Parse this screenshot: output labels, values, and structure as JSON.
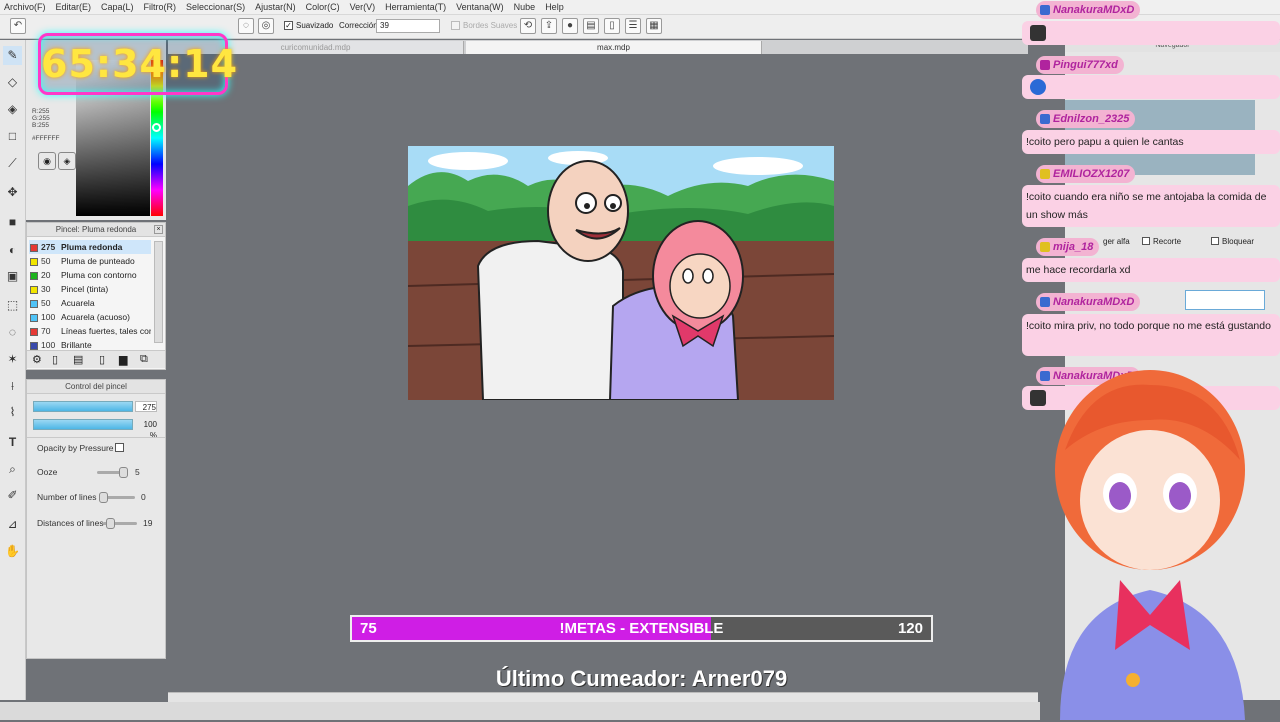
{
  "menu": [
    "Archivo(F)",
    "Editar(E)",
    "Capa(L)",
    "Filtro(R)",
    "Seleccionar(S)",
    "Ajustar(N)",
    "Color(C)",
    "Ver(V)",
    "Herramienta(T)",
    "Ventana(W)",
    "Nube",
    "Help"
  ],
  "toolbar": {
    "smoothing_label": "Suavizado",
    "correction_label": "Corrección",
    "correction_value": "39",
    "soft_edges_label": "Bordes Suaves"
  },
  "tabs": [
    "curicomunidad.mdp",
    "max.mdp"
  ],
  "timer": "65:34:14",
  "color": {
    "r": "R:255",
    "g": "G:255",
    "b": "B:255",
    "hex": "#FFFFFF"
  },
  "brush_panel": {
    "title": "Pincel: Pluma redonda",
    "items": [
      {
        "size": "275",
        "name": "Pluma redonda",
        "color": "#e53935"
      },
      {
        "size": "50",
        "name": "Pluma de punteado",
        "color": "#f2e600"
      },
      {
        "size": "20",
        "name": "Pluma con contorno",
        "color": "#1db31d"
      },
      {
        "size": "30",
        "name": "Pincel (tinta)",
        "color": "#f2e600"
      },
      {
        "size": "50",
        "name": "Acuarela",
        "color": "#4fc3f7"
      },
      {
        "size": "100",
        "name": "Acuarela (acuoso)",
        "color": "#4fc3f7"
      },
      {
        "size": "70",
        "name": "Líneas fuertes, tales con",
        "color": "#e53935"
      },
      {
        "size": "100",
        "name": "Brillante",
        "color": "#3949ab"
      }
    ]
  },
  "brush_control": {
    "title": "Control del pincel",
    "size_value": "275",
    "opacity_value": "100 %",
    "opacity_pressure": "Opacity by Pressure",
    "ooze_label": "Ooze",
    "ooze_value": "5",
    "lines_label": "Number of lines",
    "lines_value": "0",
    "dist_label": "Distances of lines",
    "dist_value": "19"
  },
  "nav": {
    "title": "Navegador",
    "alpha_label": "ger alfa",
    "clip_label": "Recorte",
    "lock_label": "Bloquear"
  },
  "chat": [
    {
      "name": "NanakuraMDxD",
      "msg": ""
    },
    {
      "name": "Pingui777xd",
      "msg": ""
    },
    {
      "name": "Ednilzon_2325",
      "msg": "!coito pero papu a quien le cantas"
    },
    {
      "name": "EMILIOZX1207",
      "msg": "!coito cuando era niño se me antojaba la comida de un show más"
    },
    {
      "name": "mija_18",
      "msg": "me hace recordarla xd"
    },
    {
      "name": "NanakuraMDxD",
      "msg": "!coito mira priv, no todo porque no me está gustando"
    },
    {
      "name": "NanakuraMDxD",
      "msg": ""
    }
  ],
  "metas": {
    "left": "75",
    "label": "!METAS - EXTENSIBLE",
    "right": "120",
    "progress_fraction": 0.62
  },
  "last_cumeador": "Último Cumeador: Arner079"
}
